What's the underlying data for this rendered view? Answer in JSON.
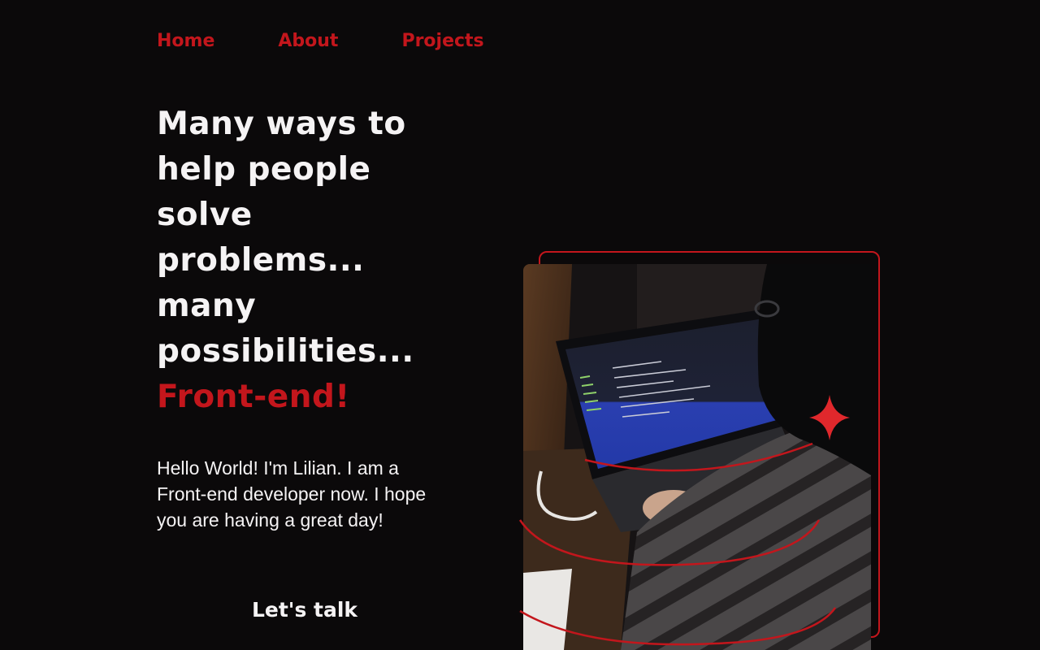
{
  "nav": {
    "items": [
      {
        "label": "Home"
      },
      {
        "label": "About"
      },
      {
        "label": "Projects"
      }
    ]
  },
  "hero": {
    "headline_lines": [
      "Many ways to",
      "help people",
      "solve",
      "problems...",
      "many",
      "possibilities..."
    ],
    "headline_accent": "Front-end!",
    "intro": "Hello World! I'm Lilian. I am a Front-end developer now. I hope you are having a great day!",
    "cta_label": "Let's talk"
  },
  "colors": {
    "background": "#0b090a",
    "accent": "#c3161c",
    "text": "#f5f3f4"
  },
  "icons": {
    "sparkle": "four-point-star-icon"
  }
}
